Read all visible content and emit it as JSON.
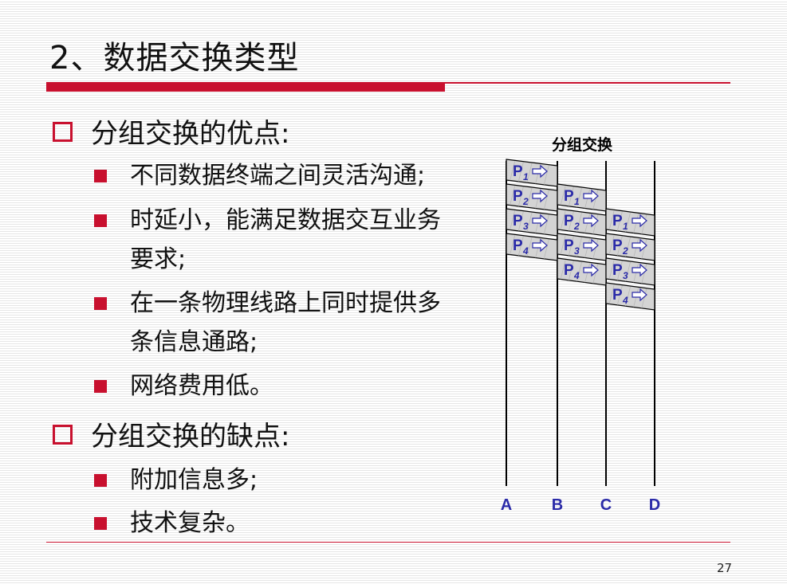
{
  "slide": {
    "title": "2、数据交换类型",
    "page_number": "27"
  },
  "advantages": {
    "heading": "分组交换的优点:",
    "items": [
      {
        "lines": [
          "不同数据终端之间灵活沟通;"
        ]
      },
      {
        "lines": [
          "时延小，能满足数据交互业务",
          "要求;"
        ]
      },
      {
        "lines": [
          "在一条物理线路上同时提供多",
          "条信息通路;"
        ]
      },
      {
        "lines": [
          "网络费用低。"
        ]
      }
    ]
  },
  "disadvantages": {
    "heading": "分组交换的缺点:",
    "items": [
      {
        "lines": [
          "附加信息多;"
        ]
      },
      {
        "lines": [
          "技术复杂。"
        ]
      }
    ]
  },
  "diagram": {
    "title": "分组交换",
    "nodes": [
      "A",
      "B",
      "C",
      "D"
    ],
    "packet_letter": "P",
    "packet_subscripts": [
      "1",
      "2",
      "3",
      "4"
    ],
    "colors": {
      "accent": "#c8102e",
      "diagram_text": "#2a2aa8",
      "packet_fill": "#d4d4d4",
      "line": "#000000"
    }
  }
}
